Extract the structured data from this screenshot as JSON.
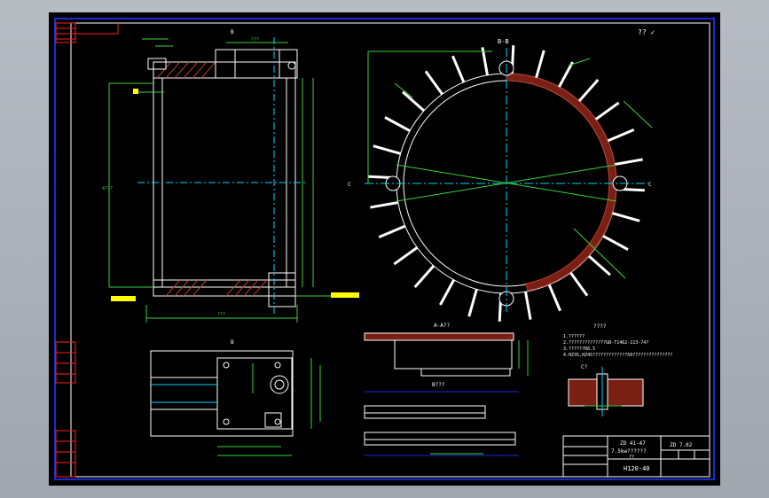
{
  "colors": {
    "background": "#000000",
    "frame": "#1c2bd6",
    "geometry": "#ffffff",
    "dimension": "#3bd23b",
    "center": "#00d5ff",
    "hatch": "#b83a2a",
    "callout": "#ffff00",
    "title_red": "#ff2020"
  },
  "labels": {
    "section_bb": "B-B",
    "section_aa": "A-A??",
    "view_b": "B???",
    "view_c": "C?",
    "check": "?? ✓",
    "cut_b_top": "B",
    "cut_b_bot": "B",
    "cut_c_left": "C",
    "cut_c_right": "C",
    "cut_a_top": "A",
    "cut_a_bot": "A",
    "dim_left_height": "4???",
    "dim_left_width": "???",
    "dim_top": "???"
  },
  "notes": {
    "header": "????",
    "line1": "1.??????",
    "line2": "2.??????????????GB-T1462-113-74?",
    "line3": "3.??????R6.5",
    "line4": "4.HZ35,HZ45?????????????50???????????????"
  },
  "title_block": {
    "cell1": "ZD 41-47",
    "cell2": "ZD 7.02",
    "cell3": "7.5kw??????",
    "cell4": "??",
    "part_no": "H120-40"
  }
}
